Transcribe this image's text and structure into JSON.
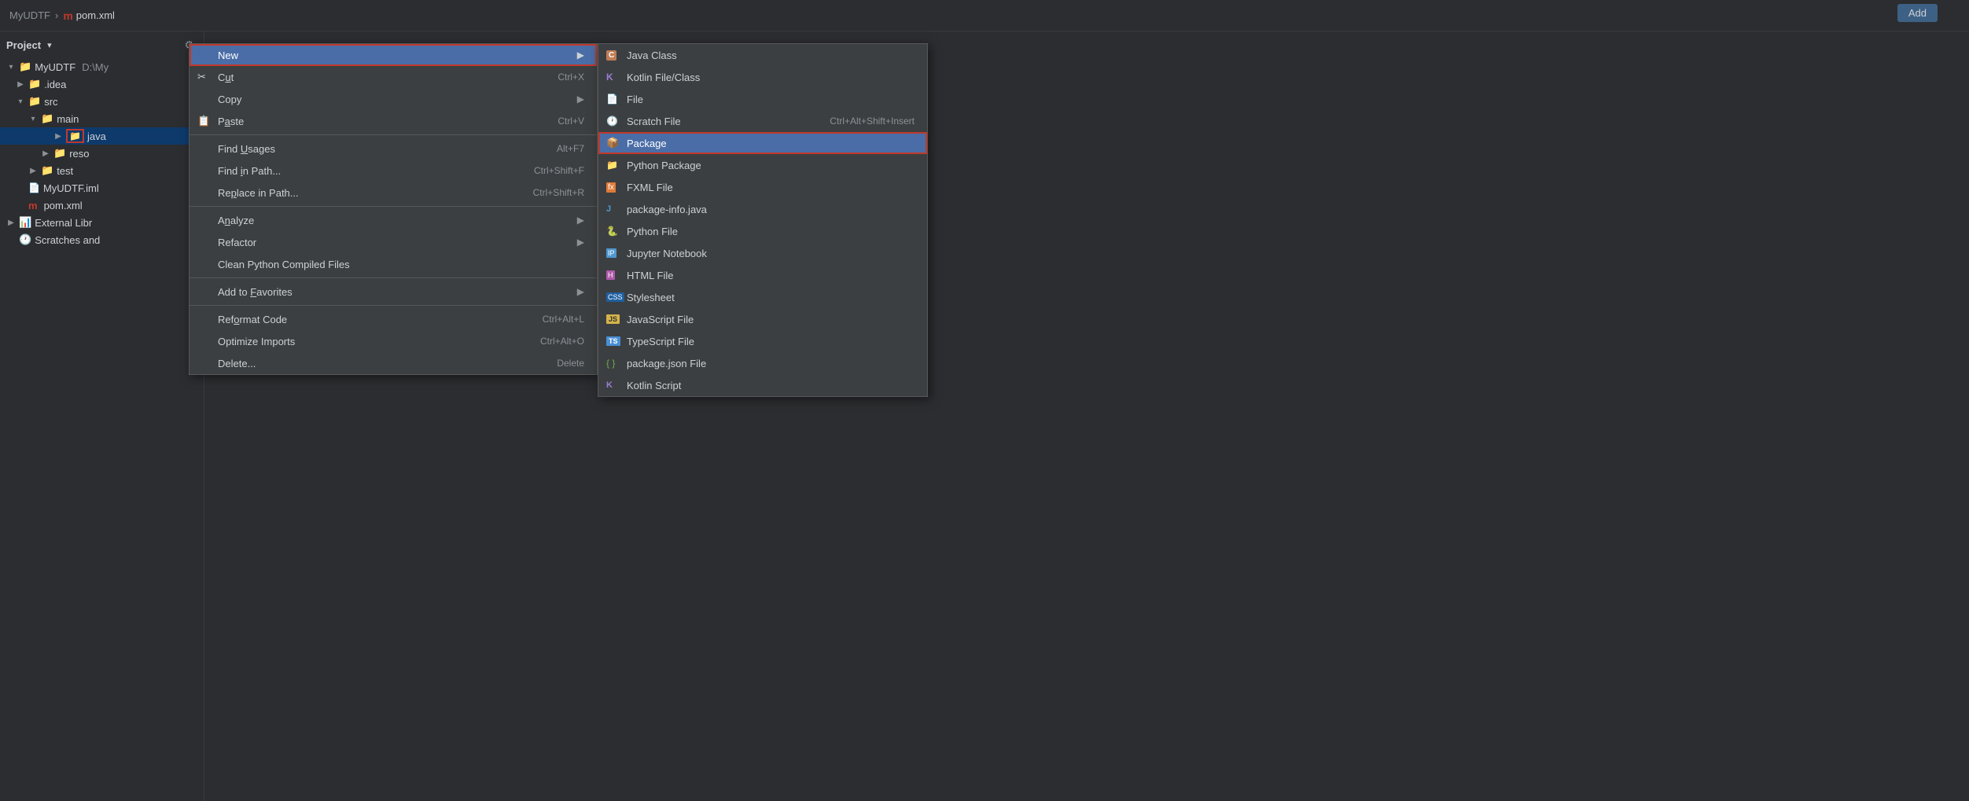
{
  "breadcrumb": {
    "project": "MyUDTF",
    "separator": "›",
    "file_icon": "m",
    "file_name": "pom.xml"
  },
  "add_button": "Add",
  "sidebar": {
    "title": "Project",
    "dropdown_label": "▾",
    "tree": [
      {
        "id": "myudtf-root",
        "label": "MyUDTF",
        "suffix": "D:\\My",
        "level": 0,
        "expanded": true,
        "type": "module"
      },
      {
        "id": "idea",
        "label": ".idea",
        "level": 1,
        "expanded": false,
        "type": "folder"
      },
      {
        "id": "src",
        "label": "src",
        "level": 1,
        "expanded": true,
        "type": "folder"
      },
      {
        "id": "main",
        "label": "main",
        "level": 2,
        "expanded": true,
        "type": "folder"
      },
      {
        "id": "java",
        "label": "java",
        "level": 3,
        "expanded": false,
        "type": "java-folder",
        "selected": true
      },
      {
        "id": "reso",
        "label": "reso",
        "level": 3,
        "expanded": false,
        "type": "folder"
      },
      {
        "id": "test",
        "label": "test",
        "level": 2,
        "expanded": false,
        "type": "folder"
      },
      {
        "id": "myudtf-iml",
        "label": "MyUDTF.iml",
        "level": 1,
        "type": "iml-file"
      },
      {
        "id": "pom-xml",
        "label": "pom.xml",
        "level": 1,
        "type": "maven-file"
      },
      {
        "id": "external-libs",
        "label": "External Libr",
        "level": 0,
        "expanded": false,
        "type": "folder"
      },
      {
        "id": "scratches",
        "label": "Scratches and",
        "level": 0,
        "expanded": false,
        "type": "scratch-folder"
      }
    ]
  },
  "context_menu": {
    "items": [
      {
        "id": "new",
        "label": "New",
        "shortcut": "",
        "has_arrow": true,
        "highlighted": true,
        "icon": ""
      },
      {
        "id": "cut",
        "label": "Cut",
        "shortcut": "Ctrl+X",
        "underline_char": "u",
        "icon": "✂"
      },
      {
        "id": "copy",
        "label": "Copy",
        "shortcut": "",
        "has_arrow": true,
        "icon": ""
      },
      {
        "id": "paste",
        "label": "Paste",
        "shortcut": "Ctrl+V",
        "underline_char": "a",
        "icon": "📋"
      },
      {
        "id": "sep1",
        "type": "separator"
      },
      {
        "id": "find-usages",
        "label": "Find Usages",
        "shortcut": "Alt+F7",
        "underline_char": "U",
        "icon": ""
      },
      {
        "id": "find-in-path",
        "label": "Find in Path...",
        "shortcut": "Ctrl+Shift+F",
        "underline_char": "i",
        "icon": ""
      },
      {
        "id": "replace-in-path",
        "label": "Replace in Path...",
        "shortcut": "Ctrl+Shift+R",
        "underline_char": "p",
        "icon": ""
      },
      {
        "id": "sep2",
        "type": "separator"
      },
      {
        "id": "analyze",
        "label": "Analyze",
        "shortcut": "",
        "has_arrow": true,
        "underline_char": "n",
        "icon": ""
      },
      {
        "id": "refactor",
        "label": "Refactor",
        "shortcut": "",
        "has_arrow": true,
        "icon": ""
      },
      {
        "id": "clean-python",
        "label": "Clean Python Compiled Files",
        "shortcut": "",
        "icon": ""
      },
      {
        "id": "sep3",
        "type": "separator"
      },
      {
        "id": "add-to-favorites",
        "label": "Add to Favorites",
        "shortcut": "",
        "has_arrow": true,
        "underline_char": "F",
        "icon": ""
      },
      {
        "id": "sep4",
        "type": "separator"
      },
      {
        "id": "reformat-code",
        "label": "Reformat Code",
        "shortcut": "Ctrl+Alt+L",
        "underline_char": "o",
        "icon": ""
      },
      {
        "id": "optimize-imports",
        "label": "Optimize Imports",
        "shortcut": "Ctrl+Alt+O",
        "icon": ""
      },
      {
        "id": "delete",
        "label": "Delete...",
        "shortcut": "Delete",
        "icon": ""
      }
    ]
  },
  "submenu": {
    "items": [
      {
        "id": "java-class",
        "label": "Java Class",
        "icon_type": "java-class",
        "shortcut": ""
      },
      {
        "id": "kotlin-file",
        "label": "Kotlin File/Class",
        "icon_type": "kotlin",
        "shortcut": ""
      },
      {
        "id": "file",
        "label": "File",
        "icon_type": "file",
        "shortcut": ""
      },
      {
        "id": "scratch-file",
        "label": "Scratch File",
        "icon_type": "scratch",
        "shortcut": "Ctrl+Alt+Shift+Insert"
      },
      {
        "id": "package",
        "label": "Package",
        "icon_type": "package",
        "shortcut": "",
        "highlighted": true
      },
      {
        "id": "python-package",
        "label": "Python Package",
        "icon_type": "python-pkg",
        "shortcut": ""
      },
      {
        "id": "fxml-file",
        "label": "FXML File",
        "icon_type": "fxml",
        "shortcut": ""
      },
      {
        "id": "package-info",
        "label": "package-info.java",
        "icon_type": "package-info",
        "shortcut": ""
      },
      {
        "id": "python-file",
        "label": "Python File",
        "icon_type": "python",
        "shortcut": ""
      },
      {
        "id": "jupyter",
        "label": "Jupyter Notebook",
        "icon_type": "jupyter",
        "shortcut": ""
      },
      {
        "id": "html-file",
        "label": "HTML File",
        "icon_type": "html",
        "shortcut": ""
      },
      {
        "id": "stylesheet",
        "label": "Stylesheet",
        "icon_type": "css",
        "shortcut": ""
      },
      {
        "id": "javascript",
        "label": "JavaScript File",
        "icon_type": "js",
        "shortcut": ""
      },
      {
        "id": "typescript",
        "label": "TypeScript File",
        "icon_type": "ts",
        "shortcut": ""
      },
      {
        "id": "package-json",
        "label": "package.json File",
        "icon_type": "json",
        "shortcut": ""
      },
      {
        "id": "kotlin-script",
        "label": "Kotlin Script",
        "icon_type": "kotlin2",
        "shortcut": ""
      }
    ]
  }
}
